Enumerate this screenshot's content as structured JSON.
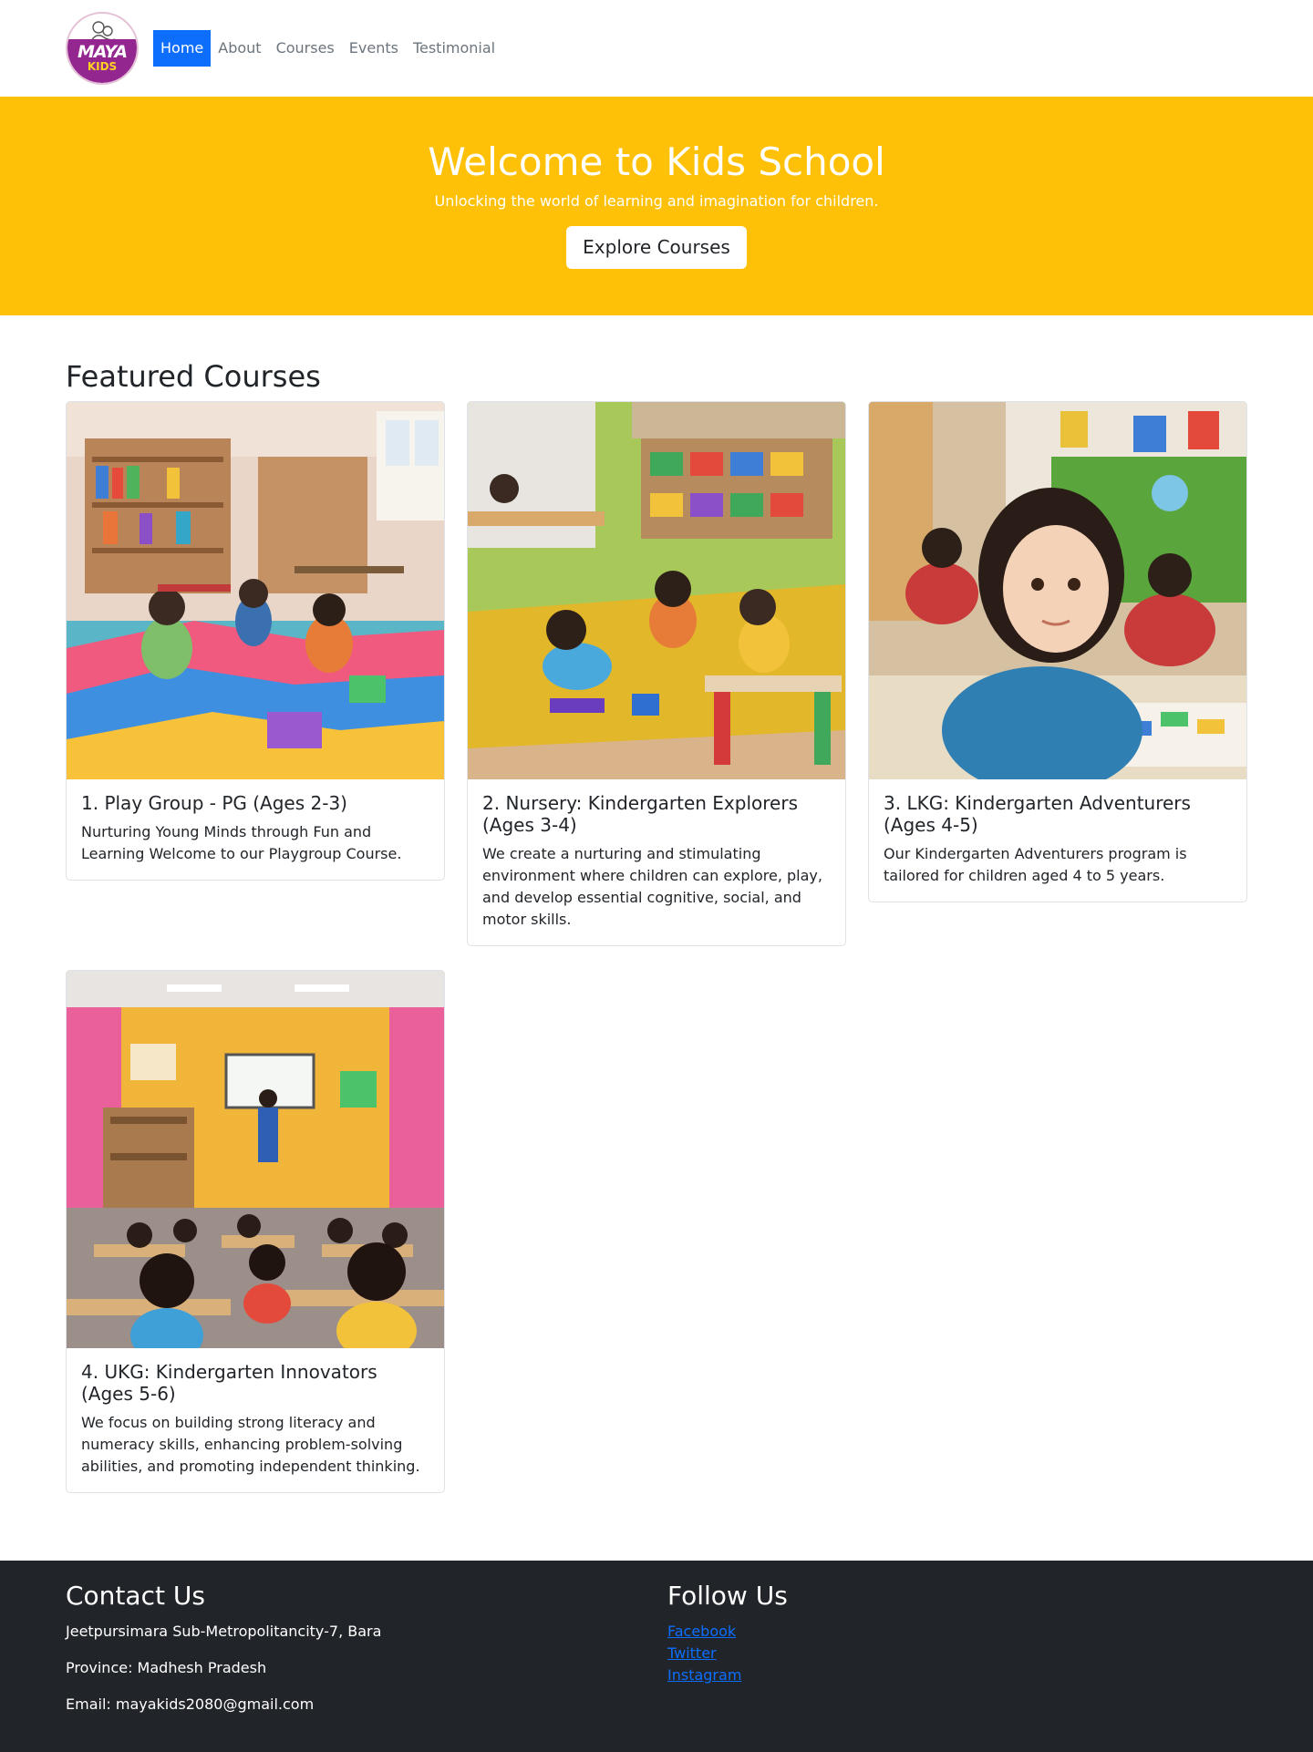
{
  "brand": {
    "logo_word": "MAYA",
    "logo_sub": "KIDS"
  },
  "nav": {
    "items": [
      {
        "label": "Home",
        "active": true
      },
      {
        "label": "About"
      },
      {
        "label": "Courses"
      },
      {
        "label": "Events"
      },
      {
        "label": "Testimonial"
      }
    ]
  },
  "hero": {
    "title": "Welcome to Kids School",
    "subtitle": "Unlocking the world of learning and imagination for children.",
    "button_label": "Explore Courses",
    "background_color": "#ffc107"
  },
  "courses": {
    "heading": "Featured Courses",
    "items": [
      {
        "title": "1. Play Group - PG (Ages 2-3)",
        "text": "Nurturing Young Minds through Fun and Learning Welcome to our Playgroup Course.",
        "image": "playgroup-classroom-photo"
      },
      {
        "title": "2. Nursery: Kindergarten Explorers (Ages 3-4)",
        "text": "We create a nurturing and stimulating environment where children can explore, play, and develop essential cognitive, social, and motor skills.",
        "image": "nursery-classroom-photo"
      },
      {
        "title": "3. LKG: Kindergarten Adventurers (Ages 4-5)",
        "text": "Our Kindergarten Adventurers program is tailored for children aged 4 to 5 years.",
        "image": "lkg-girl-drawing-photo"
      },
      {
        "title": "4. UKG: Kindergarten Innovators (Ages 5-6)",
        "text": "We focus on building strong literacy and numeracy skills, enhancing problem-solving abilities, and promoting independent thinking.",
        "image": "ukg-classroom-teacher-photo"
      }
    ]
  },
  "footer": {
    "contact": {
      "heading": "Contact Us",
      "address": "Jeetpursimara Sub-Metropolitancity-7, Bara",
      "province": "Province: Madhesh Pradesh",
      "email": "Email: mayakids2080@gmail.com"
    },
    "follow": {
      "heading": "Follow Us",
      "links": [
        "Facebook",
        "Twitter",
        "Instagram"
      ]
    },
    "link_color": "#0d6efd",
    "background_color": "#212529"
  }
}
